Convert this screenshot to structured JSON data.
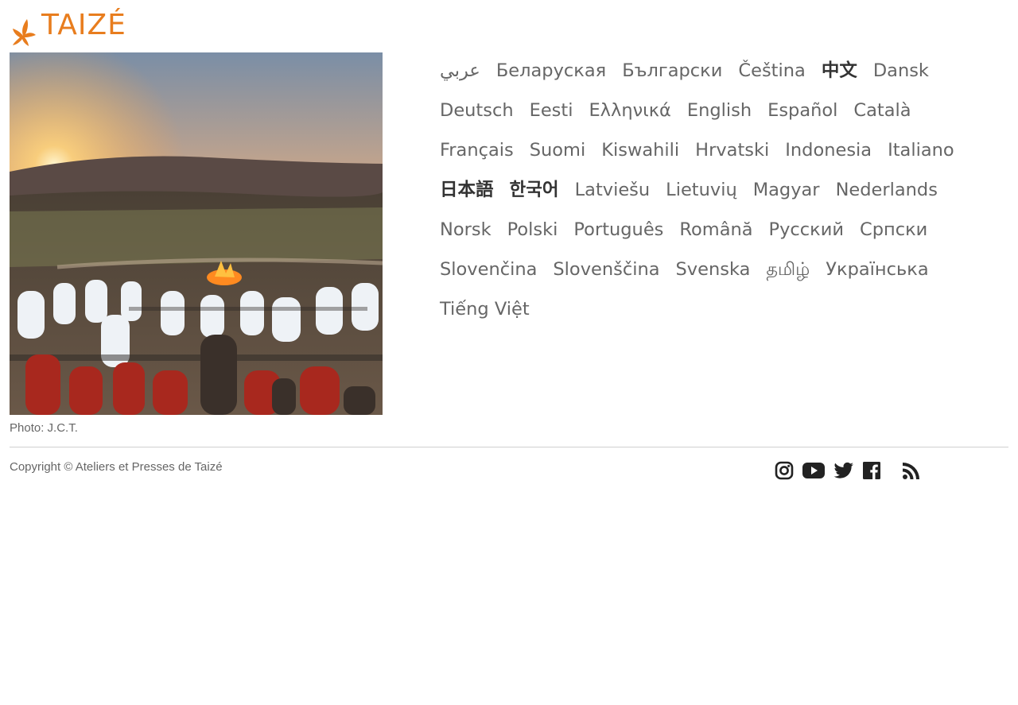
{
  "brand": {
    "name": "TAIZÉ",
    "color": "#e87d1e"
  },
  "photo": {
    "caption": "Photo: J.C.T."
  },
  "languages": [
    {
      "label": "عربي",
      "bold": false
    },
    {
      "label": "Беларуская",
      "bold": false
    },
    {
      "label": "Български",
      "bold": false
    },
    {
      "label": "Čeština",
      "bold": false
    },
    {
      "label": "中文",
      "bold": true
    },
    {
      "label": "Dansk",
      "bold": false
    },
    {
      "label": "Deutsch",
      "bold": false
    },
    {
      "label": "Eesti",
      "bold": false
    },
    {
      "label": "Ελληνικά",
      "bold": false
    },
    {
      "label": "English",
      "bold": false
    },
    {
      "label": "Español",
      "bold": false
    },
    {
      "label": "Català",
      "bold": false
    },
    {
      "label": "Français",
      "bold": false
    },
    {
      "label": "Suomi",
      "bold": false
    },
    {
      "label": "Kiswahili",
      "bold": false
    },
    {
      "label": "Hrvatski",
      "bold": false
    },
    {
      "label": "Indonesia",
      "bold": false
    },
    {
      "label": "Italiano",
      "bold": false
    },
    {
      "label": "日本語",
      "bold": true
    },
    {
      "label": "한국어",
      "bold": true
    },
    {
      "label": "Latviešu",
      "bold": false
    },
    {
      "label": "Lietuvių",
      "bold": false
    },
    {
      "label": "Magyar",
      "bold": false
    },
    {
      "label": "Nederlands",
      "bold": false
    },
    {
      "label": "Norsk",
      "bold": false
    },
    {
      "label": "Polski",
      "bold": false
    },
    {
      "label": "Português",
      "bold": false
    },
    {
      "label": "Română",
      "bold": false
    },
    {
      "label": "Русский",
      "bold": false
    },
    {
      "label": "Српски",
      "bold": false
    },
    {
      "label": "Slovenčina",
      "bold": false
    },
    {
      "label": "Slovenščina",
      "bold": false
    },
    {
      "label": "Svenska",
      "bold": false
    },
    {
      "label": "தமிழ்",
      "bold": false
    },
    {
      "label": "Українська",
      "bold": false
    },
    {
      "label": "Tiếng Việt",
      "bold": false
    }
  ],
  "footer": {
    "copyright": "Copyright © Ateliers et Presses de Taizé",
    "social": [
      {
        "icon": "instagram-icon"
      },
      {
        "icon": "youtube-icon"
      },
      {
        "icon": "twitter-icon"
      },
      {
        "icon": "facebook-icon"
      },
      {
        "icon": "rss-icon"
      }
    ]
  }
}
